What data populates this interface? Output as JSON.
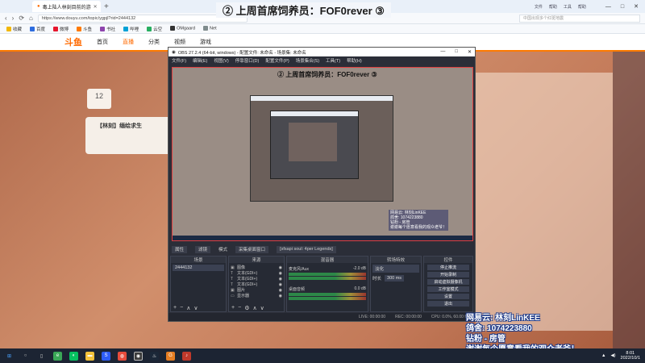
{
  "overlay": {
    "title": "② 上周首席饲养员：FOF0rever ③",
    "lines": [
      "网易云: 林刻LinKEE",
      "鸽舍: 1074223880",
      "钻粉 - 房管",
      "谢谢每个愿意看我的观众老爷！"
    ]
  },
  "browser": {
    "tab_title": "毒上陆人林刻目前的游",
    "url": "https://www.douyu.com/topic/ygpjl?rid=2444132",
    "search_placeholder": "中国出现多个红斑地震",
    "menu": [
      "文件",
      "帮助",
      "工具",
      "帮助"
    ],
    "bookmarks": [
      "收藏",
      "百度",
      "微博",
      "斗鱼",
      "书社",
      "哔哩",
      "云空",
      "OMgaard",
      "Net"
    ],
    "colors": {
      "tab_bg": "#e9f0f9",
      "accent": "#ff6a00"
    }
  },
  "douyu": {
    "logo": "斗鱼",
    "nav": [
      "首页",
      "直播",
      "分类",
      "视频",
      "游戏"
    ],
    "level": "12",
    "streamer": "【林刻】缅绘求生"
  },
  "obs": {
    "title": "OBS 27.2.4 (64-bit, windows) - 配置文件: 未命名 - 场景集: 未命名",
    "menu": [
      "文件(F)",
      "编辑(E)",
      "视图(V)",
      "停靠窗口(D)",
      "配置文件(P)",
      "场景集合(S)",
      "工具(T)",
      "帮助(H)"
    ],
    "preview_title": "② 上周首席饲养员：FOF0rever ③",
    "preview_overlay": [
      "网易云: 林刻LinKEE",
      "鸽舍: 1074223880",
      "钻粉 - 房管",
      "谢谢每个愿意看我的观众老爷！"
    ],
    "controls": [
      "属性",
      "滤镜",
      "模式",
      "采集桌面窗口"
    ],
    "filter_text": "[sfsapi soul: 4per Legends]",
    "docks": {
      "scenes": {
        "header": "场景",
        "items": [
          "2444132"
        ]
      },
      "sources": {
        "header": "来源",
        "items": [
          "图像",
          "文本(GDI+)",
          "文本(GDI+)",
          "文本(GDI+)",
          "图片",
          "显示器"
        ]
      },
      "mixer": {
        "header": "混音器",
        "channels": [
          {
            "name": "麦克风/Aux",
            "db": "-2.0 dB"
          },
          {
            "name": "桌面音频",
            "db": "0.0 dB"
          }
        ]
      },
      "transitions": {
        "header": "转场特效",
        "type": "淡化",
        "duration_label": "时长",
        "duration": "300 ms"
      },
      "controls": {
        "header": "控件",
        "buttons": [
          "停止推流",
          "开始录制",
          "启动虚拟摄像机",
          "工作室模式",
          "设置",
          "退出"
        ]
      }
    },
    "status": [
      "LIVE: 00:00:00",
      "REC: 00:00:00",
      "CPU: 0.0%, 60.00 fps"
    ]
  },
  "taskbar": {
    "time": "8:01",
    "date": "2022/10/1",
    "icons": [
      "start",
      "search",
      "taskview",
      "chrome",
      "wechat",
      "explorer",
      "obs",
      "steam",
      "edge",
      "app"
    ]
  }
}
